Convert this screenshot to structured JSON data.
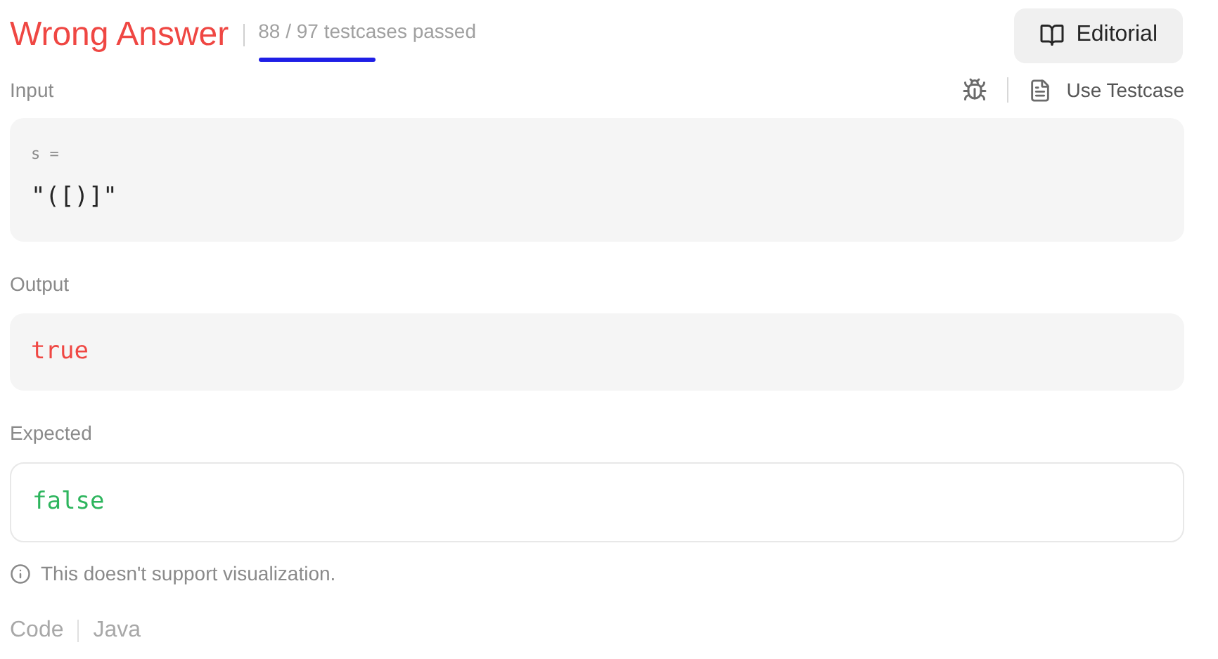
{
  "header": {
    "status": "Wrong Answer",
    "summary": "88 / 97 testcases passed",
    "editorial_button": "Editorial"
  },
  "sections": [
    {
      "kind": "input",
      "label": "Input",
      "variable": "s =",
      "value": "\"([)]\""
    },
    {
      "kind": "output",
      "label": "Output",
      "value": "true"
    },
    {
      "kind": "expected",
      "label": "Expected",
      "value": "false"
    }
  ],
  "use_testcase_button": "Use Testcase",
  "notice": "This doesn't support visualization.",
  "code_header": {
    "label": "Code",
    "language": "Java"
  }
}
